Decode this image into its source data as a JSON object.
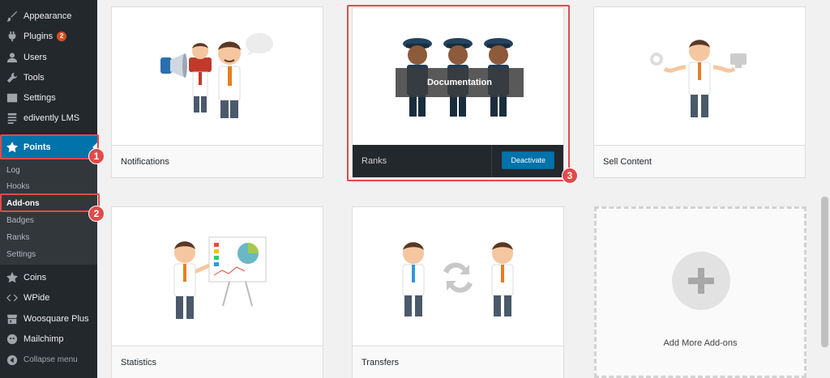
{
  "sidebar": {
    "items": [
      {
        "label": "Appearance",
        "icon": "paintbrush-icon"
      },
      {
        "label": "Plugins",
        "icon": "plugin-icon",
        "badge": "2"
      },
      {
        "label": "Users",
        "icon": "user-icon"
      },
      {
        "label": "Tools",
        "icon": "wrench-icon"
      },
      {
        "label": "Settings",
        "icon": "settings-icon"
      },
      {
        "label": "edivently LMS",
        "icon": "document-icon"
      }
    ],
    "active": {
      "label": "Points",
      "icon": "star-icon"
    },
    "submenu": [
      "Log",
      "Hooks",
      "Add-ons",
      "Badges",
      "Ranks",
      "Settings"
    ],
    "submenu_current": "Add-ons",
    "lower_items": [
      {
        "label": "Coins",
        "icon": "star-icon"
      },
      {
        "label": "WPide",
        "icon": "code-icon"
      },
      {
        "label": "Woosquare Plus",
        "icon": "store-icon"
      },
      {
        "label": "Mailchimp",
        "icon": "mailchimp-icon"
      }
    ],
    "collapse": "Collapse menu"
  },
  "annotations": [
    "1",
    "2",
    "3"
  ],
  "addons": {
    "notifications": {
      "title": "Notifications"
    },
    "ranks": {
      "title": "Ranks",
      "overlay": "Documentation",
      "button": "Deactivate"
    },
    "sell_content": {
      "title": "Sell Content"
    },
    "statistics": {
      "title": "Statistics"
    },
    "transfers": {
      "title": "Transfers"
    },
    "add_more": {
      "label": "Add More Add-ons"
    }
  },
  "colors": {
    "admin_bar": "#23282d",
    "accent": "#0073aa",
    "highlight": "#e04b4b"
  }
}
